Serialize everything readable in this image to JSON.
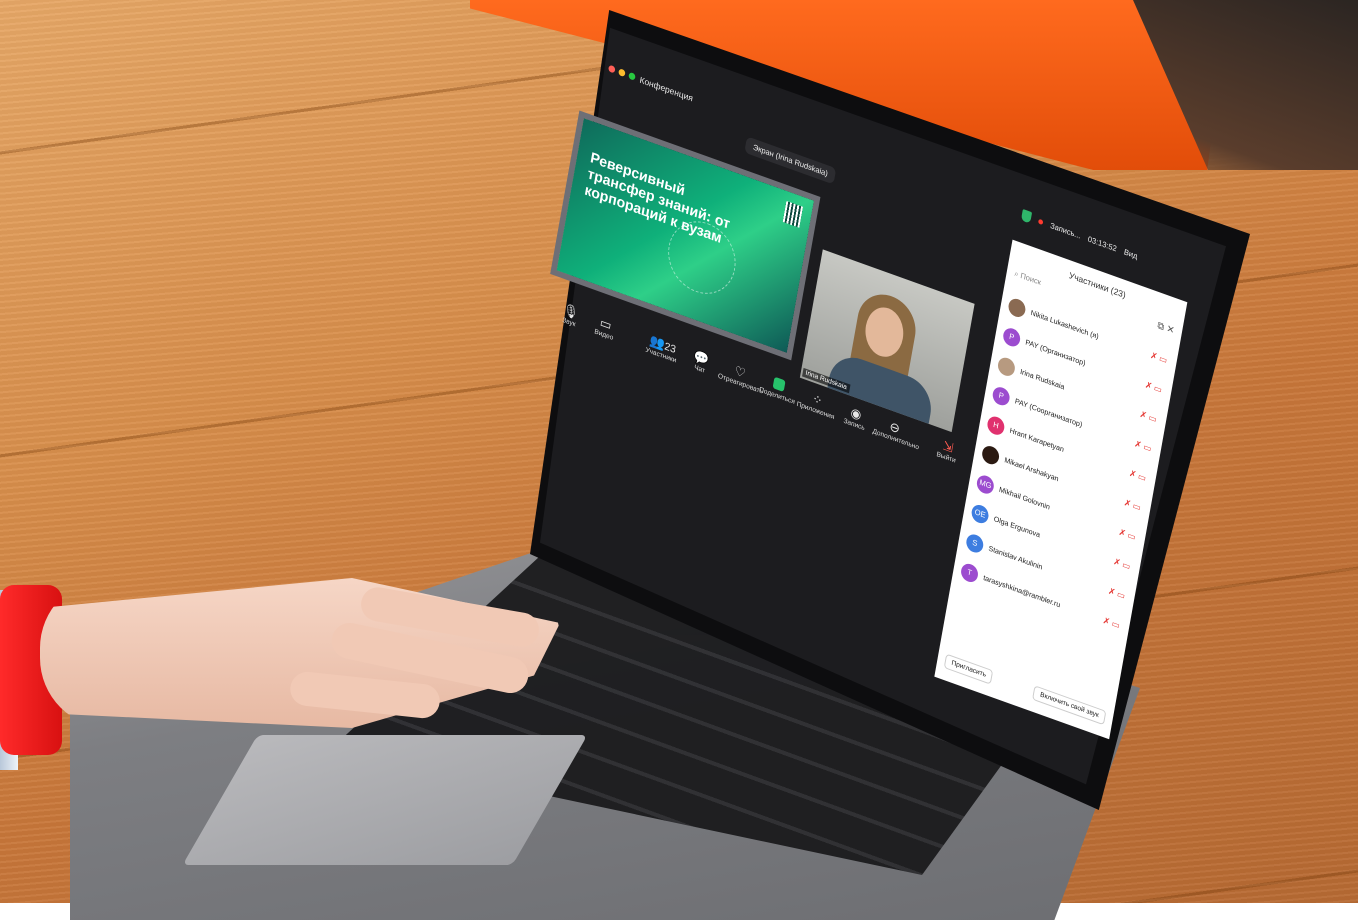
{
  "app": {
    "name": "Конференция",
    "sharing_pill": "Экран (Irina Rudskaia)",
    "recording": "Запись...",
    "timer": "03:13:52",
    "view_label": "Вид"
  },
  "slide": {
    "title": "Реверсивный трансфер знаний: от корпораций к вузам"
  },
  "video": {
    "speaker_name": "Irina Rudskaia"
  },
  "participants_panel": {
    "title": "Участники (23)",
    "search_placeholder": "Поиск",
    "participants": [
      {
        "name": "Nikita Lukashevich (я)",
        "initials": "",
        "color": "#8a6a52"
      },
      {
        "name": "PAY (Организатор)",
        "initials": "P",
        "color": "#9c4ccf"
      },
      {
        "name": "Irina Rudskaia",
        "initials": "",
        "color": "#b79a80"
      },
      {
        "name": "PAY (Соорганизатор)",
        "initials": "P",
        "color": "#9c4ccf"
      },
      {
        "name": "Hrant Karapetyan",
        "initials": "H",
        "color": "#e0316e"
      },
      {
        "name": "Mikael Arshakyan",
        "initials": "",
        "color": "#2b1a12"
      },
      {
        "name": "Mikhail Golovnin",
        "initials": "MG",
        "color": "#9c4ccf"
      },
      {
        "name": "Olga Ergunova",
        "initials": "OE",
        "color": "#3d7de0"
      },
      {
        "name": "Stanislav Akulinin",
        "initials": "S",
        "color": "#3d7de0"
      },
      {
        "name": "tarasyshkina@rambler.ru",
        "initials": "T",
        "color": "#9c4ccf"
      }
    ],
    "invite_button": "Пригласить",
    "unmute_button": "Включить свой звук"
  },
  "toolbar": {
    "audio": "Звук",
    "video": "Видео",
    "participants_count": "23",
    "participants": "Участники",
    "chat": "Чат",
    "react": "Отреагировать",
    "share": "Поделиться",
    "apps": "Приложения",
    "record": "Запись",
    "more": "Дополнительно",
    "exit": "Выйти"
  },
  "colors": {
    "accent_green": "#27c26b",
    "muted_red": "#e53935",
    "panel_bg": "#ffffff",
    "meeting_bg": "#1c1c1f"
  }
}
